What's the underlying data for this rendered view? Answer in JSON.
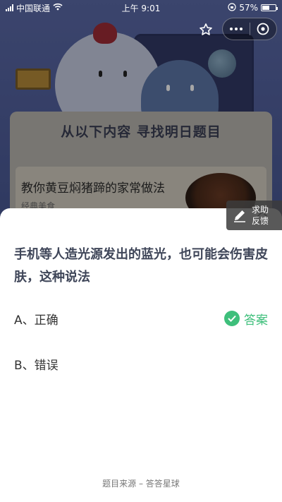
{
  "status_bar": {
    "carrier": "中国联通",
    "time": "上午 9:01",
    "battery": "57%",
    "battery_level": 0.57
  },
  "background": {
    "banner_title": "从以下内容 寻找明日题目",
    "card_title": "教你黄豆焖猪蹄的家常做法",
    "card_subtitle": "经典美食"
  },
  "help_button": {
    "line1": "求助",
    "line2": "反馈"
  },
  "quiz": {
    "question": "手机等人造光源发出的蓝光，也可能会伤害皮肤，这种说法",
    "options": [
      {
        "label": "A、正确",
        "is_answer": true
      },
      {
        "label": "B、错误",
        "is_answer": false
      }
    ],
    "answer_label": "答案"
  },
  "footer": {
    "source": "题目来源 – 答答星球"
  },
  "colors": {
    "answer_green": "#3ebf7b",
    "question_text": "#3f4659"
  },
  "icons": [
    "wifi-icon",
    "lock-rotation-icon",
    "star-icon",
    "more-icon",
    "close-circle-icon",
    "pen-icon",
    "close-icon",
    "check-icon"
  ]
}
